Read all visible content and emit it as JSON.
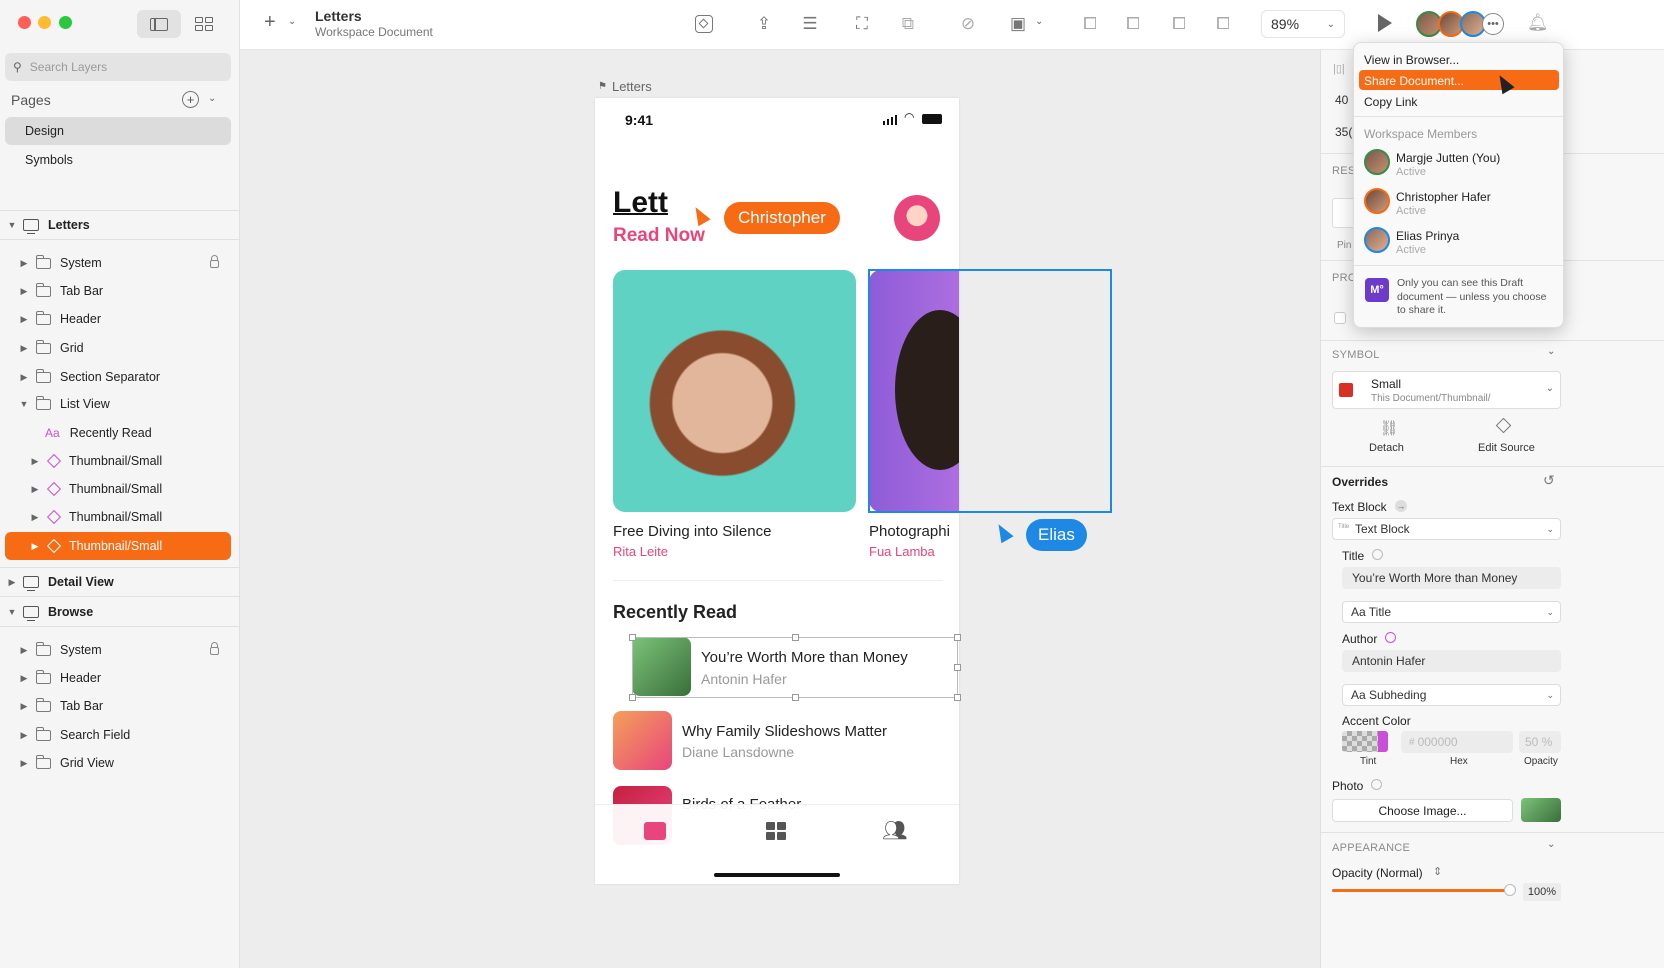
{
  "left_panel": {
    "search_placeholder": "Search Layers",
    "pages_title": "Pages",
    "pages": [
      "Design",
      "Symbols"
    ],
    "groups": [
      {
        "name": "Letters",
        "children": [
          "System",
          "Tab Bar",
          "Header",
          "Grid",
          "Section Separator",
          "List View"
        ]
      },
      {
        "list_view_children": [
          "Recently Read",
          "Thumbnail/Small",
          "Thumbnail/Small",
          "Thumbnail/Small",
          "Thumbnail/Small"
        ]
      },
      {
        "name": "Detail View"
      },
      {
        "name": "Browse",
        "children": [
          "System",
          "Header",
          "Tab Bar",
          "Search Field",
          "Grid View"
        ]
      }
    ]
  },
  "toolbar": {
    "doc_title": "Letters",
    "doc_subtitle": "Workspace Document",
    "zoom": "89%"
  },
  "canvas": {
    "artboard_label": "Letters",
    "status_time": "9:41",
    "app_title": "Lett",
    "read_now": "Read Now",
    "cursor_christopher": "Christopher",
    "cursor_elias": "Elias",
    "card1_title": "Free Diving into Silence",
    "card1_author": "Rita Leite",
    "card2_title": "Photographi",
    "card2_author": "Fua Lamba",
    "recently_read_heading": "Recently Read",
    "list": [
      {
        "title": "You’re Worth More than Money",
        "author": "Antonin Hafer"
      },
      {
        "title": "Why Family Slideshows Matter",
        "author": "Diane Lansdowne"
      },
      {
        "title": "Birds of a Feather",
        "author": ""
      }
    ]
  },
  "menu": {
    "items": [
      "View in Browser...",
      "Share Document...",
      "Copy Link"
    ],
    "members_header": "Workspace Members",
    "members": [
      {
        "name": "Margje Jutten (You)",
        "status": "Active"
      },
      {
        "name": "Christopher Hafer",
        "status": "Active"
      },
      {
        "name": "Elias Prinya",
        "status": "Active"
      }
    ],
    "notice": "Only you can see this Draft document — unless you choose to share it.",
    "notice_badge": "M°"
  },
  "inspector": {
    "partial_values": [
      "40",
      "35("
    ],
    "partial_labels": [
      "RESI",
      "Pin",
      "PRO"
    ],
    "symbol_header": "SYMBOL",
    "symbol_name": "Small",
    "symbol_path": "This Document/Thumbnail/",
    "detach": "Detach",
    "edit_source": "Edit Source",
    "overrides": "Overrides",
    "text_block_label": "Text Block",
    "text_block_value": "Text Block",
    "title_label": "Title",
    "title_value": "You’re Worth More than Money",
    "title_style": "Aa Title",
    "author_label": "Author",
    "author_value": "Antonin Hafer",
    "author_style": "Aa Subheding",
    "accent_label": "Accent Color",
    "hex_placeholder": "000000",
    "opacity_placeholder": "50 %",
    "tint_label": "Tint",
    "hex_label": "Hex",
    "opacity_label": "Opacity",
    "photo_label": "Photo",
    "choose_image": "Choose Image...",
    "appearance_header": "APPEARANCE",
    "opacity_mode": "Opacity (Normal)",
    "opacity_value": "100%"
  },
  "colors": {
    "accent_orange": "#f76b15",
    "selection_blue": "#1e88e5",
    "pink": "#e8457c",
    "elias_blue": "#1e88e5"
  }
}
